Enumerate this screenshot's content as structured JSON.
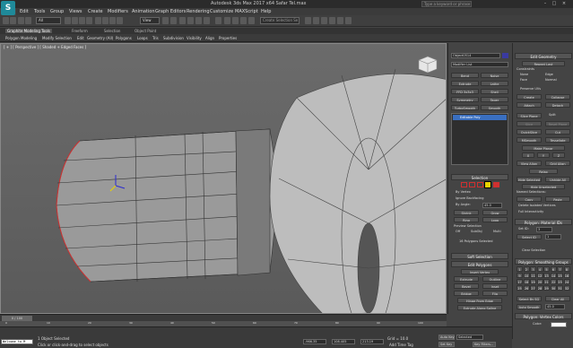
{
  "window": {
    "title": "Autodesk 3ds Max 2017 x64    Safar Tel.max",
    "search_placeholder": "Type a keyword or phrase",
    "logo": "3ds-max-logo"
  },
  "menubar": {
    "items": [
      "Edit",
      "Tools",
      "Group",
      "Views",
      "Create",
      "Modifiers",
      "Animation",
      "Graph Editors",
      "Rendering",
      "Customize",
      "MAXScript",
      "Help"
    ]
  },
  "toolbar": {
    "filter_select": "All",
    "view_select": "View",
    "selection_set_placeholder": "Create Selection Se"
  },
  "ribbon": {
    "tabs": [
      "Graphite Modeling Tools",
      "Freeform",
      "Selection",
      "Object Paint"
    ],
    "panel_items": [
      "Polygon Modeling",
      "Modify Selection",
      "Edit",
      "Geometry (All)",
      "Polygons",
      "Loops",
      "Tris",
      "Subdivision",
      "Visibility",
      "Align",
      "Properties"
    ]
  },
  "viewport": {
    "label": "[ + ] [ Perspective ] [ Shaded + Edged Faces ]"
  },
  "command_panel": {
    "object_name": "Object0514",
    "modifier_list": "Modifier List",
    "buttons": [
      [
        "Bend",
        "Noise"
      ],
      [
        "Extrude",
        "Lathe"
      ],
      [
        "FFD 3x3x3",
        "Shell"
      ],
      [
        "Symmetry",
        "Taper"
      ],
      [
        "TurboSmooth",
        "Smooth"
      ]
    ],
    "stack_item": "Editable Poly",
    "selection_title": "Selection",
    "by_vertex": "By Vertex",
    "ignore_backfacing": "Ignore Backfacing",
    "by_angle": "By Angle:",
    "by_angle_value": "45.0",
    "shrink": "Shrink",
    "grow": "Grow",
    "ring": "Ring",
    "loop": "Loop",
    "preview_selection": "Preview Selection",
    "preview_off": "Off",
    "preview_subobj": "SubObj",
    "preview_multi": "Multi",
    "selected_count": "16 Polygons Selected",
    "soft_selection": "Soft Selection",
    "edit_polygons": "Edit Polygons",
    "insert_vertex": "Insert Vertex",
    "extrude": "Extrude",
    "outline": "Outline",
    "bevel": "Bevel",
    "inset": "Inset",
    "bridge": "Bridge",
    "flip": "Flip",
    "hinge": "Hinge From Edge",
    "extrude_spline": "Extrude Along Spline",
    "edit_triangulation": "Edit Triangulation",
    "retriangulate": "Retriangulate",
    "turn": "Turn"
  },
  "right_panel": {
    "edit_geometry": "Edit Geometry",
    "repeat_last": "Repeat Last",
    "constraints": "Constraints",
    "c_none": "None",
    "c_edge": "Edge",
    "c_face": "Face",
    "c_normal": "Normal",
    "preserve_uvs": "Preserve UVs",
    "create": "Create",
    "collapse": "Collapse",
    "attach": "Attach",
    "detach": "Detach",
    "slice_plane": "Slice Plane",
    "split": "Split",
    "slice": "Slice",
    "reset_plane": "Reset Plane",
    "quickslice": "QuickSlice",
    "cut": "Cut",
    "msmooth": "MSmooth",
    "tessellate": "Tessellate",
    "make_planar": "Make Planar",
    "x": "X",
    "y": "Y",
    "z": "Z",
    "view_align": "View Align",
    "grid_align": "Grid Align",
    "relax": "Relax",
    "hide_selected": "Hide Selected",
    "unhide_all": "Unhide All",
    "hide_unselected": "Hide Unselected",
    "named_selections": "Named Selections:",
    "copy": "Copy",
    "paste": "Paste",
    "delete_isolated": "Delete Isolated Vertices",
    "full_interactivity": "Full Interactivity",
    "material_ids": "Polygon: Material IDs",
    "set_id": "Set ID:",
    "set_id_value": "3",
    "select_id": "Select ID",
    "select_id_value": "1",
    "clear_selection": "Clear Selection",
    "smoothing_groups": "Polygon: Smoothing Groups",
    "sg": [
      "1",
      "2",
      "3",
      "4",
      "5",
      "6",
      "7",
      "8",
      "9",
      "10",
      "11",
      "12",
      "13",
      "14",
      "15",
      "16",
      "17",
      "18",
      "19",
      "20",
      "21",
      "22",
      "23",
      "24",
      "25",
      "26",
      "27",
      "28",
      "29",
      "30",
      "31",
      "32"
    ],
    "select_by_sg": "Select By SG",
    "clear_all": "Clear All",
    "auto_smooth": "Auto Smooth",
    "auto_smooth_value": "45.0",
    "vertex_colors": "Polygon: Vertex Colors",
    "color": "Color:"
  },
  "timeline": {
    "frame": "0 / 100",
    "ticks": [
      "0",
      "10",
      "20",
      "30",
      "40",
      "50",
      "60",
      "70",
      "80",
      "90",
      "100"
    ]
  },
  "status": {
    "maxscript": "Welcome to M",
    "objects_selected": "1 Object Selected",
    "prompt": "Click or click-and-drag to select objects",
    "x_value": "-966.35",
    "y_value": "108.405",
    "z_value": "213.19",
    "grid": "Grid = 10.0",
    "add_time_tag": "Add Time Tag",
    "auto_key": "Auto Key",
    "selected": "Selected",
    "set_key": "Set Key",
    "key_filters": "Key Filters..."
  },
  "colors": {
    "accent": "#1f8a9a",
    "selected_poly": "#cc3333",
    "highlight_yellow": "#e8d200"
  }
}
